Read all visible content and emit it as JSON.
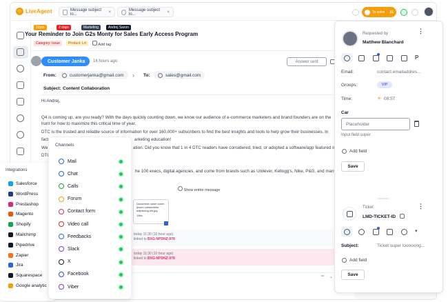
{
  "colors": {
    "accent_blue": "#2d8cff",
    "status_orange": "#f59e0b",
    "online_green": "#22c55e",
    "log_highlight": "#d6336c"
  },
  "topbar": {
    "brand": "LiveAgent",
    "tabs": [
      {
        "label": "Message subject lo...",
        "icon": "mail-icon"
      },
      {
        "label": "Message subject lo...",
        "icon": "check-circle-icon"
      }
    ],
    "status_label": "To solve",
    "status_count": "31"
  },
  "ticket": {
    "badges": [
      {
        "label": "10pm",
        "color": "#f59e0b"
      },
      {
        "label": "2 days",
        "color": "#dc2626"
      },
      {
        "label": "Marketing",
        "color": "#374151"
      },
      {
        "label": "Andrej Saxon",
        "color": "#111827"
      }
    ],
    "subject": "Your Reminder to Join G2s Monty for Sales Early Access Program",
    "labels": [
      {
        "label": "Category: Issue",
        "bg": "#fee2e2",
        "color": "#b91c1c"
      },
      {
        "label": "Product: Lrt",
        "bg": "#fef3c7",
        "color": "#b45309"
      }
    ],
    "add_tag": "Add tag"
  },
  "message": {
    "customer": "Customer Janka",
    "time_ago": "16 hours ago",
    "answer_sent": "Answer sent",
    "from_label": "From:",
    "from_email": "customerjanka@gmail.com",
    "to_label": "To:",
    "to_email": "sales@gmail.com",
    "subject_label": "Subject:",
    "subject_value": "Content Collaboration",
    "greeting": "Hi Andrej,",
    "para1": "Q4 is coming up, are you ready? With the days quickly counting down, we know our audience of e-commerce marketers and brand founders are on the",
    "para1b": "hunt for how to maximize this critical time of year.",
    "para2": "DTC is the trusted and reliable source of information for over 160,000+ subscribers to find the best insights and tools to help grow their businesses. In",
    "para2b": "arketing education!",
    "para2c": "fact",
    "para3a": "We",
    "para3b": "ation. Did you know that 1 in 4 DTC readers have considered, tried, or adopted a software/app featured in",
    "para3c": "DTC",
    "para4": "he 100 execs, digital agencies, and come from brands such as Unilever, Kellogg's, Nike, P&G, and many m",
    "show_message": "Show entire message",
    "attachment_text": "Document name lorem ipsum consectetur adipiscing elit.jpg",
    "attachment_size": "15kb",
    "logs": [
      {
        "time": "today 11:30 (10 hour ago)",
        "linked": "linked to",
        "ticket": "BXG-NPDNZ-978"
      },
      {
        "time": "today 11:30 (10 hour ago)",
        "linked": "linked to",
        "ticket": "BXG-NPDNZ-978"
      }
    ]
  },
  "contact_card": {
    "requested_by_label": "Requested by",
    "name": "Matthew Blanchard",
    "email_label": "Email:",
    "email_value": "contact.emailaddres...",
    "groups_label": "Groups:",
    "groups_value": "VIP",
    "time_label": "Time:",
    "time_value": "08:57",
    "car_label": "Car",
    "car_placeholder": "Placeholder",
    "input_hint": "Input field super",
    "add_field": "Add field",
    "save": "Save"
  },
  "ticket_card": {
    "ticket_label": "Ticket",
    "ticket_id": "LMD-TICKET-ID",
    "subject_label": "Subject:",
    "subject_value": "Ticket super looooong...",
    "add_field": "Add field",
    "save": "Save"
  },
  "integrations": {
    "title": "Integrations",
    "items": [
      {
        "label": "Salesforce",
        "color": "#0ea5e9"
      },
      {
        "label": "WordPress",
        "color": "#1e3a8a"
      },
      {
        "label": "Prestashop",
        "color": "#db2777"
      },
      {
        "label": "Magento",
        "color": "#ea580c"
      },
      {
        "label": "Shopify",
        "color": "#16a34a"
      },
      {
        "label": "Mailchimp",
        "color": "#111827"
      },
      {
        "label": "Pipedrive",
        "color": "#111827"
      },
      {
        "label": "Zapier",
        "color": "#f97316"
      },
      {
        "label": "Jira",
        "color": "#2563eb"
      },
      {
        "label": "Squarespace",
        "color": "#111827"
      },
      {
        "label": "Google analytic",
        "color": "#f59e0b"
      }
    ]
  },
  "channels": {
    "title": "Channels",
    "items": [
      {
        "label": "Mail",
        "icon": "at-icon",
        "color": "#2563eb"
      },
      {
        "label": "Chat",
        "icon": "chat-icon",
        "color": "#2563eb"
      },
      {
        "label": "Calls",
        "icon": "phone-icon",
        "color": "#16a34a"
      },
      {
        "label": "Forum",
        "icon": "forum-icon",
        "color": "#f59e0b"
      },
      {
        "label": "Contact form",
        "icon": "form-icon",
        "color": "#db2777"
      },
      {
        "label": "Video call",
        "icon": "video-icon",
        "color": "#dc2626"
      },
      {
        "label": "Feedbacks",
        "icon": "feedback-icon",
        "color": "#2563eb"
      },
      {
        "label": "Slack",
        "icon": "slack-icon",
        "color": "#7c3aed"
      },
      {
        "label": "X",
        "icon": "x-icon",
        "color": "#111827"
      },
      {
        "label": "Facebook",
        "icon": "facebook-icon",
        "color": "#1d4ed8"
      },
      {
        "label": "Viber",
        "icon": "viber-icon",
        "color": "#7c3aed"
      }
    ]
  }
}
